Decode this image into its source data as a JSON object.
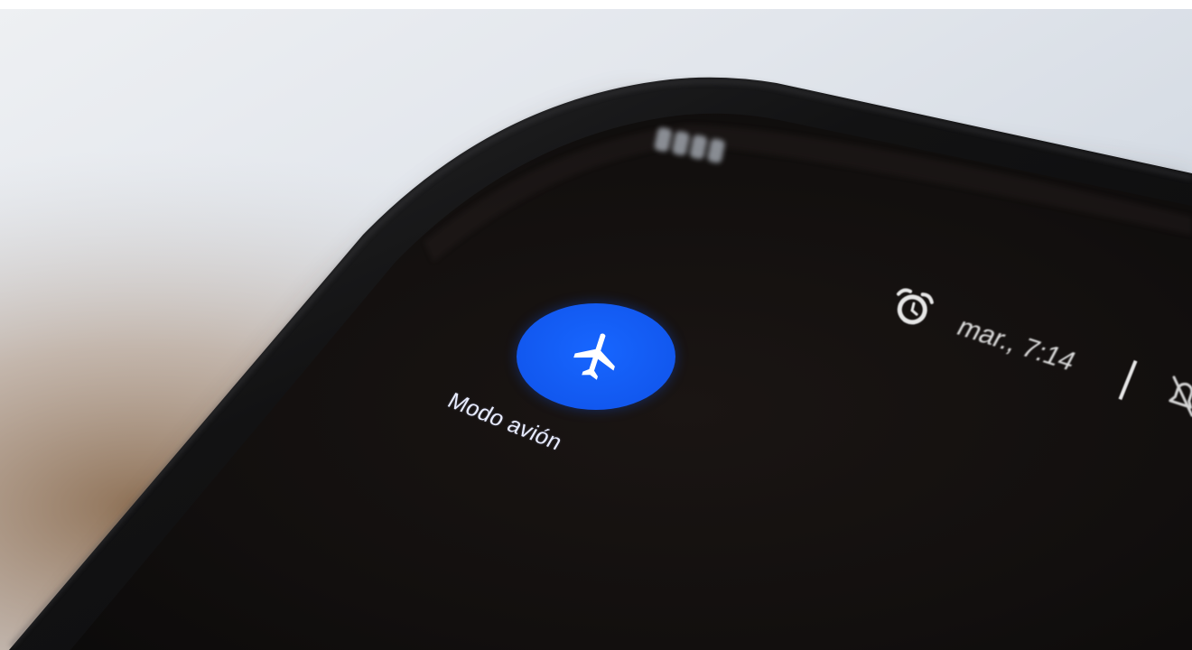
{
  "quick_settings": {
    "airplane_tile": {
      "label": "Modo avión",
      "icon": "airplane-icon",
      "state": "on",
      "color": "#1766ff"
    }
  },
  "status_bar": {
    "alarm_icon": "alarm-clock-icon",
    "alarm_text": "mar., 7:14",
    "separator": "|",
    "silent_icon": "bell-off-icon"
  },
  "colors": {
    "background_wall": "#d7dde5",
    "phone_body": "#0f0f10",
    "screen": "#141110",
    "accent": "#1766ff"
  }
}
